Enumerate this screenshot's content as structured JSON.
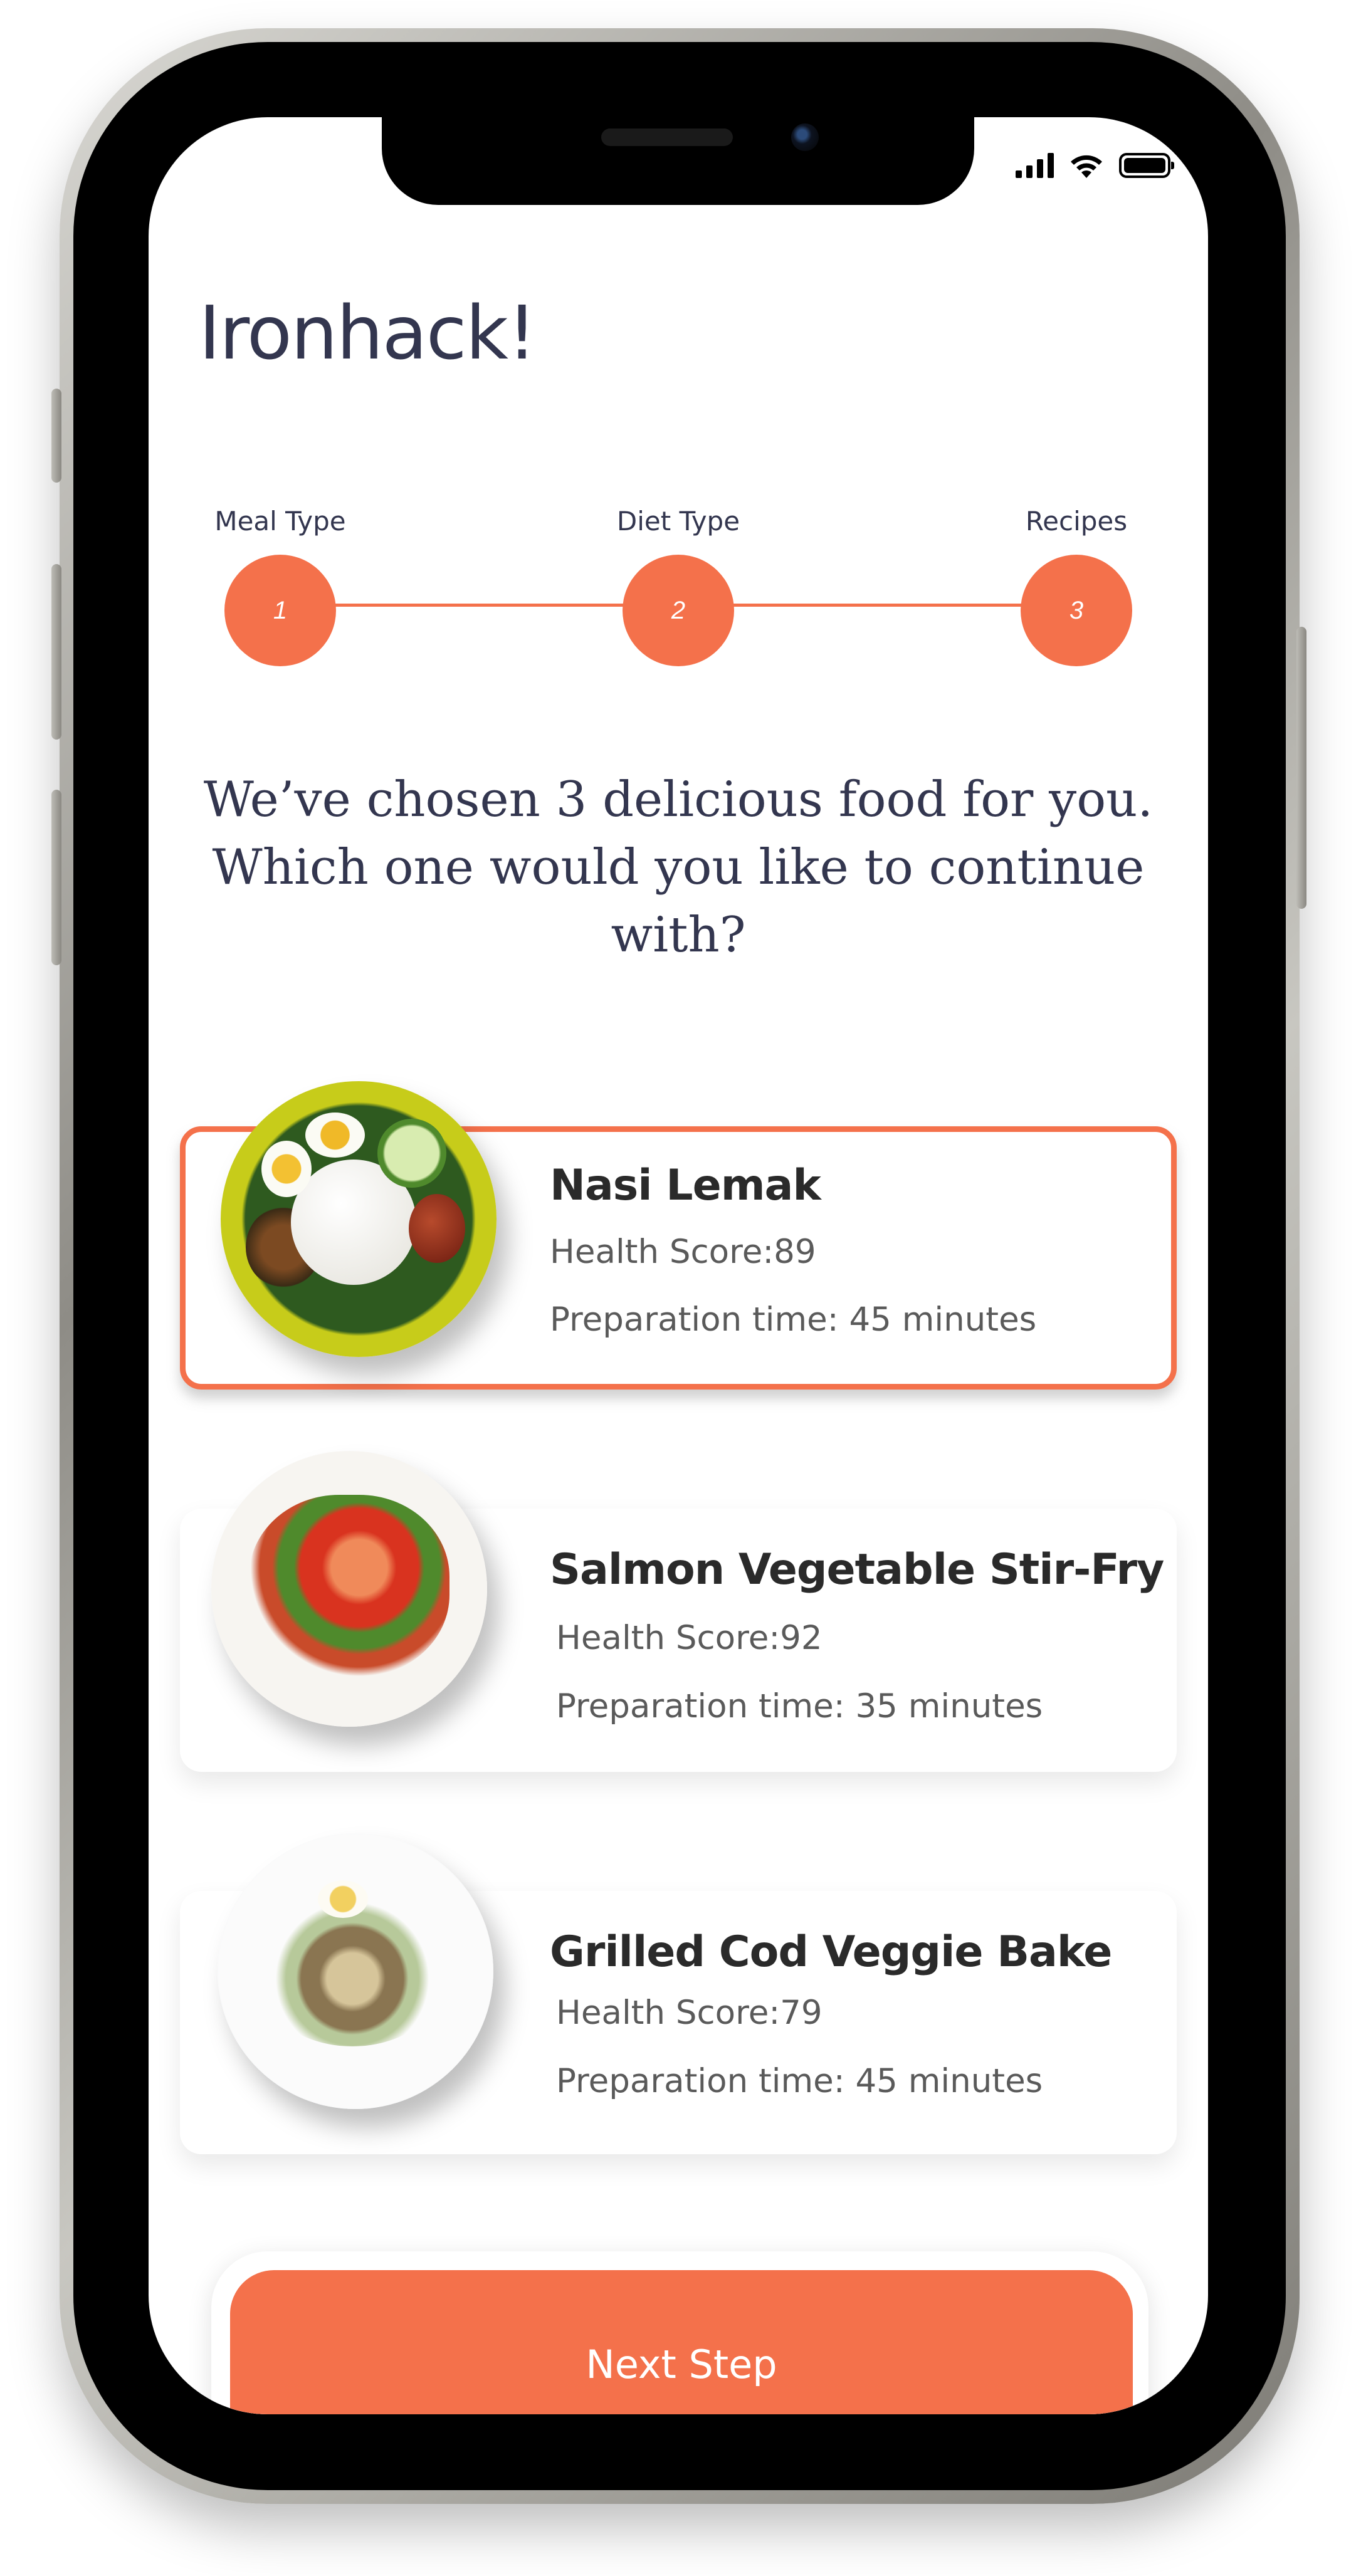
{
  "app": {
    "title": "Ironhack!"
  },
  "status_bar": {
    "icons": [
      "signal-icon",
      "wifi-icon",
      "battery-icon"
    ]
  },
  "stepper": {
    "steps": [
      {
        "label": "Meal Type",
        "number": "1"
      },
      {
        "label": "Diet Type",
        "number": "2"
      },
      {
        "label": "Recipes",
        "number": "3"
      }
    ],
    "accent_color": "#f4714b"
  },
  "prompt": {
    "text": "We’ve chosen 3 delicious food for you. Which one would you like to continue with?"
  },
  "recipes": [
    {
      "name": "Nasi Lemak",
      "health_score": "Health Score:89",
      "prep_time": "Preparation time: 45 minutes",
      "selected": true
    },
    {
      "name": "Salmon Vegetable Stir-Fry",
      "health_score": "Health Score:92",
      "prep_time": "Preparation time: 35 minutes",
      "selected": false
    },
    {
      "name": "Grilled Cod Veggie Bake",
      "health_score": "Health Score:79",
      "prep_time": "Preparation time: 45 minutes",
      "selected": false
    }
  ],
  "footer": {
    "next_label": "Next Step"
  },
  "colors": {
    "accent": "#f4714b",
    "title": "#33364f"
  }
}
